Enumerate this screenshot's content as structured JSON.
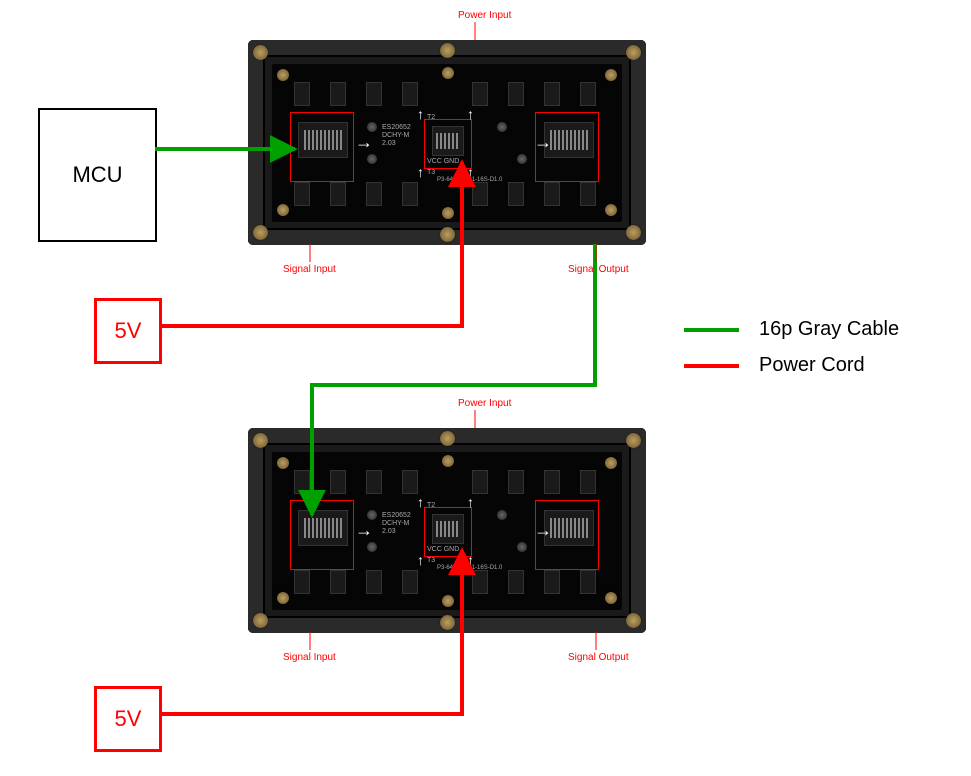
{
  "mcu": {
    "label": "MCU"
  },
  "power1": {
    "label": "5V"
  },
  "power2": {
    "label": "5V"
  },
  "legend": {
    "green": "16p Gray Cable",
    "red": "Power Cord"
  },
  "module": {
    "sig_in": "Signal Input",
    "sig_out": "Signal Output",
    "pwr_in": "Power Input",
    "pcb_id": "P3-6432-2121-16S-D1.0",
    "pcb_mfr1": "ES20652",
    "pcb_mfr2": "DCHY-M",
    "pcb_mfr3": "2.03",
    "pwr_pins": "VCC  GND"
  }
}
